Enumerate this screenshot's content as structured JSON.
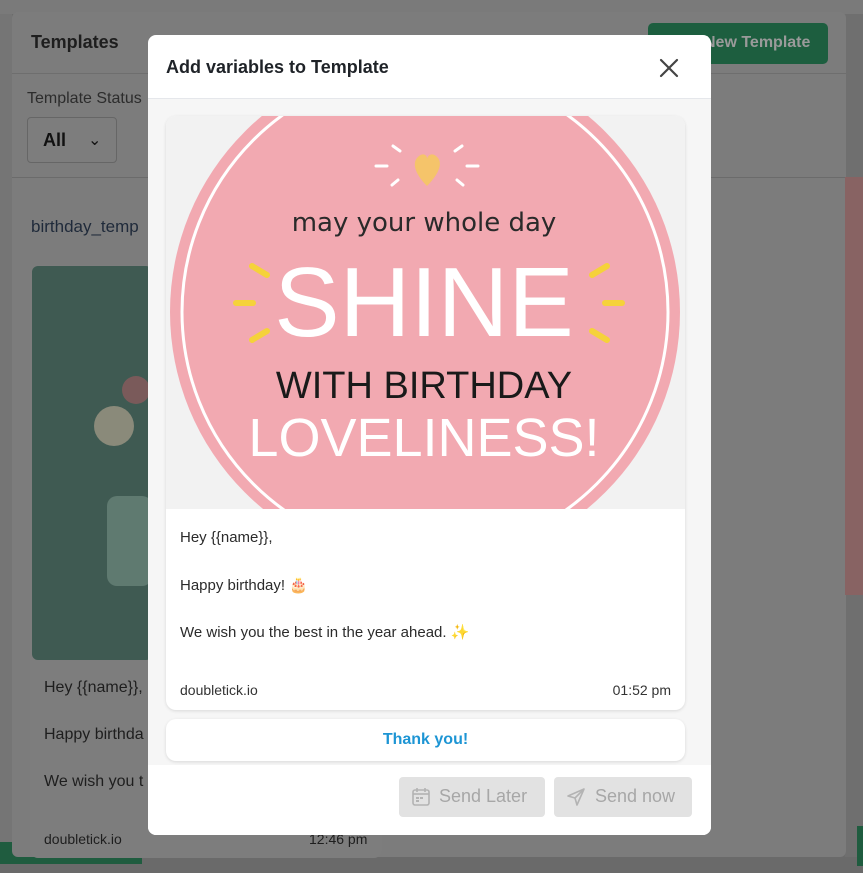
{
  "background": {
    "title": "Templates",
    "new_template_label": "New Template",
    "template_status_label": "Template Status",
    "status_value": "All",
    "template_name": "birthday_temp",
    "card": {
      "line1": "Hey {{name}},",
      "line2": "Happy birthda",
      "line3": "We wish you t",
      "footer": "doubletick.io",
      "time": "12:46 pm"
    }
  },
  "modal": {
    "title": "Add variables to Template",
    "close_icon": "close-icon",
    "preview": {
      "image_text": {
        "line1": "may your whole day",
        "line2": "SHINE",
        "line3": "WITH BIRTHDAY",
        "line4": "LOVELINESS!"
      },
      "greeting": "Hey {{name}},",
      "line2": "Happy birthday! 🎂",
      "line3": "We wish you the best in the year ahead. ✨",
      "footer": "doubletick.io",
      "time": "01:52 pm"
    },
    "quick_reply": "Thank you!",
    "send_later_label": "Send Later",
    "send_now_label": "Send now",
    "colors": {
      "accent_blue": "#1d95d4",
      "disabled_bg": "#e2e2e2",
      "pink_circle": "#f2a9b1",
      "heart": "#f5c46a"
    }
  }
}
